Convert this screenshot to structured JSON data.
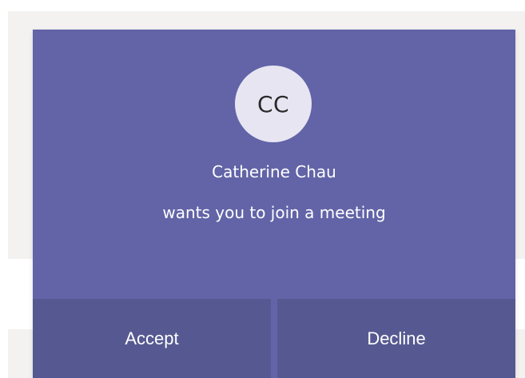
{
  "toast": {
    "avatar_initials": "CC",
    "caller_name": "Catherine Chau",
    "message": "wants you to join a meeting",
    "accept_label": "Accept",
    "decline_label": "Decline"
  },
  "colors": {
    "toast_background": "#6264a7",
    "button_background": "#565991",
    "avatar_background": "#e8e5f3",
    "page_background": "#f3f2f1"
  }
}
